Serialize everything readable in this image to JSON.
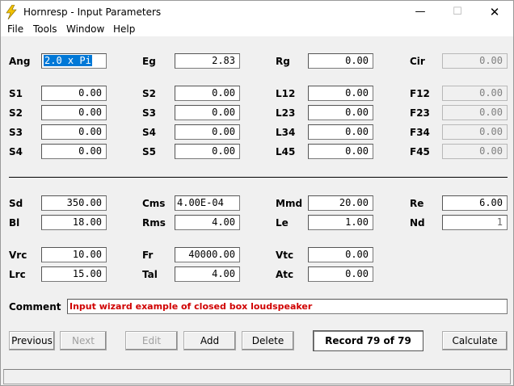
{
  "window": {
    "title": "Hornresp - Input Parameters",
    "controls": {
      "minimize": "—",
      "maximize": "☐",
      "close": "✕"
    }
  },
  "menu": [
    "File",
    "Tools",
    "Window",
    "Help"
  ],
  "fields": {
    "Ang": "2.0 x Pi",
    "Eg": "2.83",
    "Rg": "0.00",
    "Cir": "0.00",
    "S1_a": "0.00",
    "S2_b": "0.00",
    "L12": "0.00",
    "F12": "0.00",
    "S2_a": "0.00",
    "S3_b": "0.00",
    "L23": "0.00",
    "F23": "0.00",
    "S3_a": "0.00",
    "S4_b": "0.00",
    "L34": "0.00",
    "F34": "0.00",
    "S4_a": "0.00",
    "S5_b": "0.00",
    "L45": "0.00",
    "F45": "0.00",
    "Sd": "350.00",
    "Cms": "4.00E-04",
    "Mmd": "20.00",
    "Re": "6.00",
    "Bl": "18.00",
    "Rms": "4.00",
    "Le": "1.00",
    "Nd": "1",
    "Vrc": "10.00",
    "Fr": "40000.00",
    "Vtc": "0.00",
    "Lrc": "15.00",
    "Tal": "4.00",
    "Atc": "0.00"
  },
  "labels": {
    "Ang": "Ang",
    "Eg": "Eg",
    "Rg": "Rg",
    "Cir": "Cir",
    "S1_a": "S1",
    "S2_b": "S2",
    "L12": "L12",
    "F12": "F12",
    "S2_a": "S2",
    "S3_b": "S3",
    "L23": "L23",
    "F23": "F23",
    "S3_a": "S3",
    "S4_b": "S4",
    "L34": "L34",
    "F34": "F34",
    "S4_a": "S4",
    "S5_b": "S5",
    "L45": "L45",
    "F45": "F45",
    "Sd": "Sd",
    "Cms": "Cms",
    "Mmd": "Mmd",
    "Re": "Re",
    "Bl": "Bl",
    "Rms": "Rms",
    "Le": "Le",
    "Nd": "Nd",
    "Vrc": "Vrc",
    "Fr": "Fr",
    "Vtc": "Vtc",
    "Lrc": "Lrc",
    "Tal": "Tal",
    "Atc": "Atc",
    "Comment": "Comment"
  },
  "comment": "Input wizard example of closed box loudspeaker",
  "buttons": {
    "previous": "Previous",
    "next": "Next",
    "edit": "Edit",
    "add": "Add",
    "delete": "Delete",
    "calculate": "Calculate"
  },
  "record": "Record 79 of 79",
  "colors": {
    "comment_text": "#d00000",
    "selection": "#0078d7",
    "icon": "#f2c200"
  }
}
